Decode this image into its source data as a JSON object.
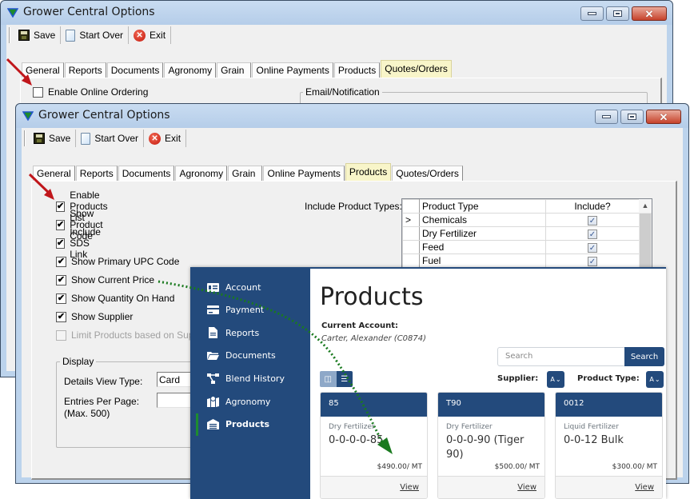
{
  "back_window": {
    "title": "Grower Central Options",
    "toolbar": {
      "save": "Save",
      "start_over": "Start Over",
      "exit": "Exit"
    },
    "tabs": [
      "General",
      "Reports",
      "Documents",
      "Agronomy",
      "Grain",
      "Online Payments",
      "Products",
      "Quotes/Orders"
    ],
    "active_tab": "Quotes/Orders",
    "enable_online_ordering": {
      "label": "Enable Online Ordering",
      "checked": false
    },
    "email_group_label": "Email/Notification"
  },
  "front_window": {
    "title": "Grower Central Options",
    "toolbar": {
      "save": "Save",
      "start_over": "Start Over",
      "exit": "Exit"
    },
    "tabs": [
      "General",
      "Reports",
      "Documents",
      "Agronomy",
      "Grain",
      "Online Payments",
      "Products",
      "Quotes/Orders"
    ],
    "active_tab": "Products",
    "options": [
      {
        "label": "Enable Products List",
        "checked": true,
        "enabled": true
      },
      {
        "label": "Show Product Code",
        "checked": true,
        "enabled": true
      },
      {
        "label": "Include SDS Link",
        "checked": true,
        "enabled": true
      },
      {
        "label": "Show Primary UPC Code",
        "checked": true,
        "enabled": true
      },
      {
        "label": "Show Current Price",
        "checked": true,
        "enabled": true
      },
      {
        "label": "Show Quantity On Hand",
        "checked": true,
        "enabled": true
      },
      {
        "label": "Show Supplier",
        "checked": true,
        "enabled": true
      },
      {
        "label": "Limit Products based on Suppli",
        "checked": false,
        "enabled": false
      }
    ],
    "product_types_label": "Include Product Types:",
    "product_types_grid": {
      "columns": [
        "Product Type",
        "Include?"
      ],
      "rows": [
        {
          "indicator": ">",
          "type": "Chemicals",
          "include": true
        },
        {
          "indicator": "",
          "type": "Dry Fertilizer",
          "include": true
        },
        {
          "indicator": "",
          "type": "Feed",
          "include": true
        },
        {
          "indicator": "",
          "type": "Fuel",
          "include": true
        }
      ]
    },
    "display_group": {
      "label": "Display",
      "details_view_type_label": "Details View Type:",
      "details_view_type_value": "Card",
      "entries_per_page_label": "Entries Per Page:",
      "entries_per_page_hint": "(Max. 500)",
      "entries_per_page_value": ""
    }
  },
  "portal": {
    "nav": [
      {
        "label": "Account",
        "icon": "account-icon",
        "active": false
      },
      {
        "label": "Payment",
        "icon": "credit-card-icon",
        "active": false
      },
      {
        "label": "Reports",
        "icon": "file-icon",
        "active": false
      },
      {
        "label": "Documents",
        "icon": "folder-icon",
        "active": false
      },
      {
        "label": "Blend History",
        "icon": "sitemap-icon",
        "active": false
      },
      {
        "label": "Agronomy",
        "icon": "map-marker-icon",
        "active": false
      },
      {
        "label": "Products",
        "icon": "warehouse-icon",
        "active": true
      }
    ],
    "page_title": "Products",
    "current_account_label": "Current Account:",
    "current_account_name": "Carter, Alexander (C0874)",
    "search_placeholder": "Search",
    "search_button": "Search",
    "supplier_label": "Supplier:",
    "supplier_value": "A",
    "product_type_label": "Product Type:",
    "product_type_value": "A",
    "cards": [
      {
        "code": "85",
        "type": "Dry Fertilizer",
        "name": "0-0-0-0-85",
        "price": "$490.00/ MT",
        "link": "View"
      },
      {
        "code": "T90",
        "type": "Dry Fertilizer",
        "name": "0-0-0-90 (Tiger 90)",
        "price": "$500.00/ MT",
        "link": "View"
      },
      {
        "code": "0012",
        "type": "Liquid Fertilizer",
        "name": "0-0-12 Bulk",
        "price": "$300.00/ MT",
        "link": "View"
      }
    ]
  },
  "annotations": {
    "arrow_color": "#c0161b",
    "connector_color": "#1a7a1f"
  }
}
